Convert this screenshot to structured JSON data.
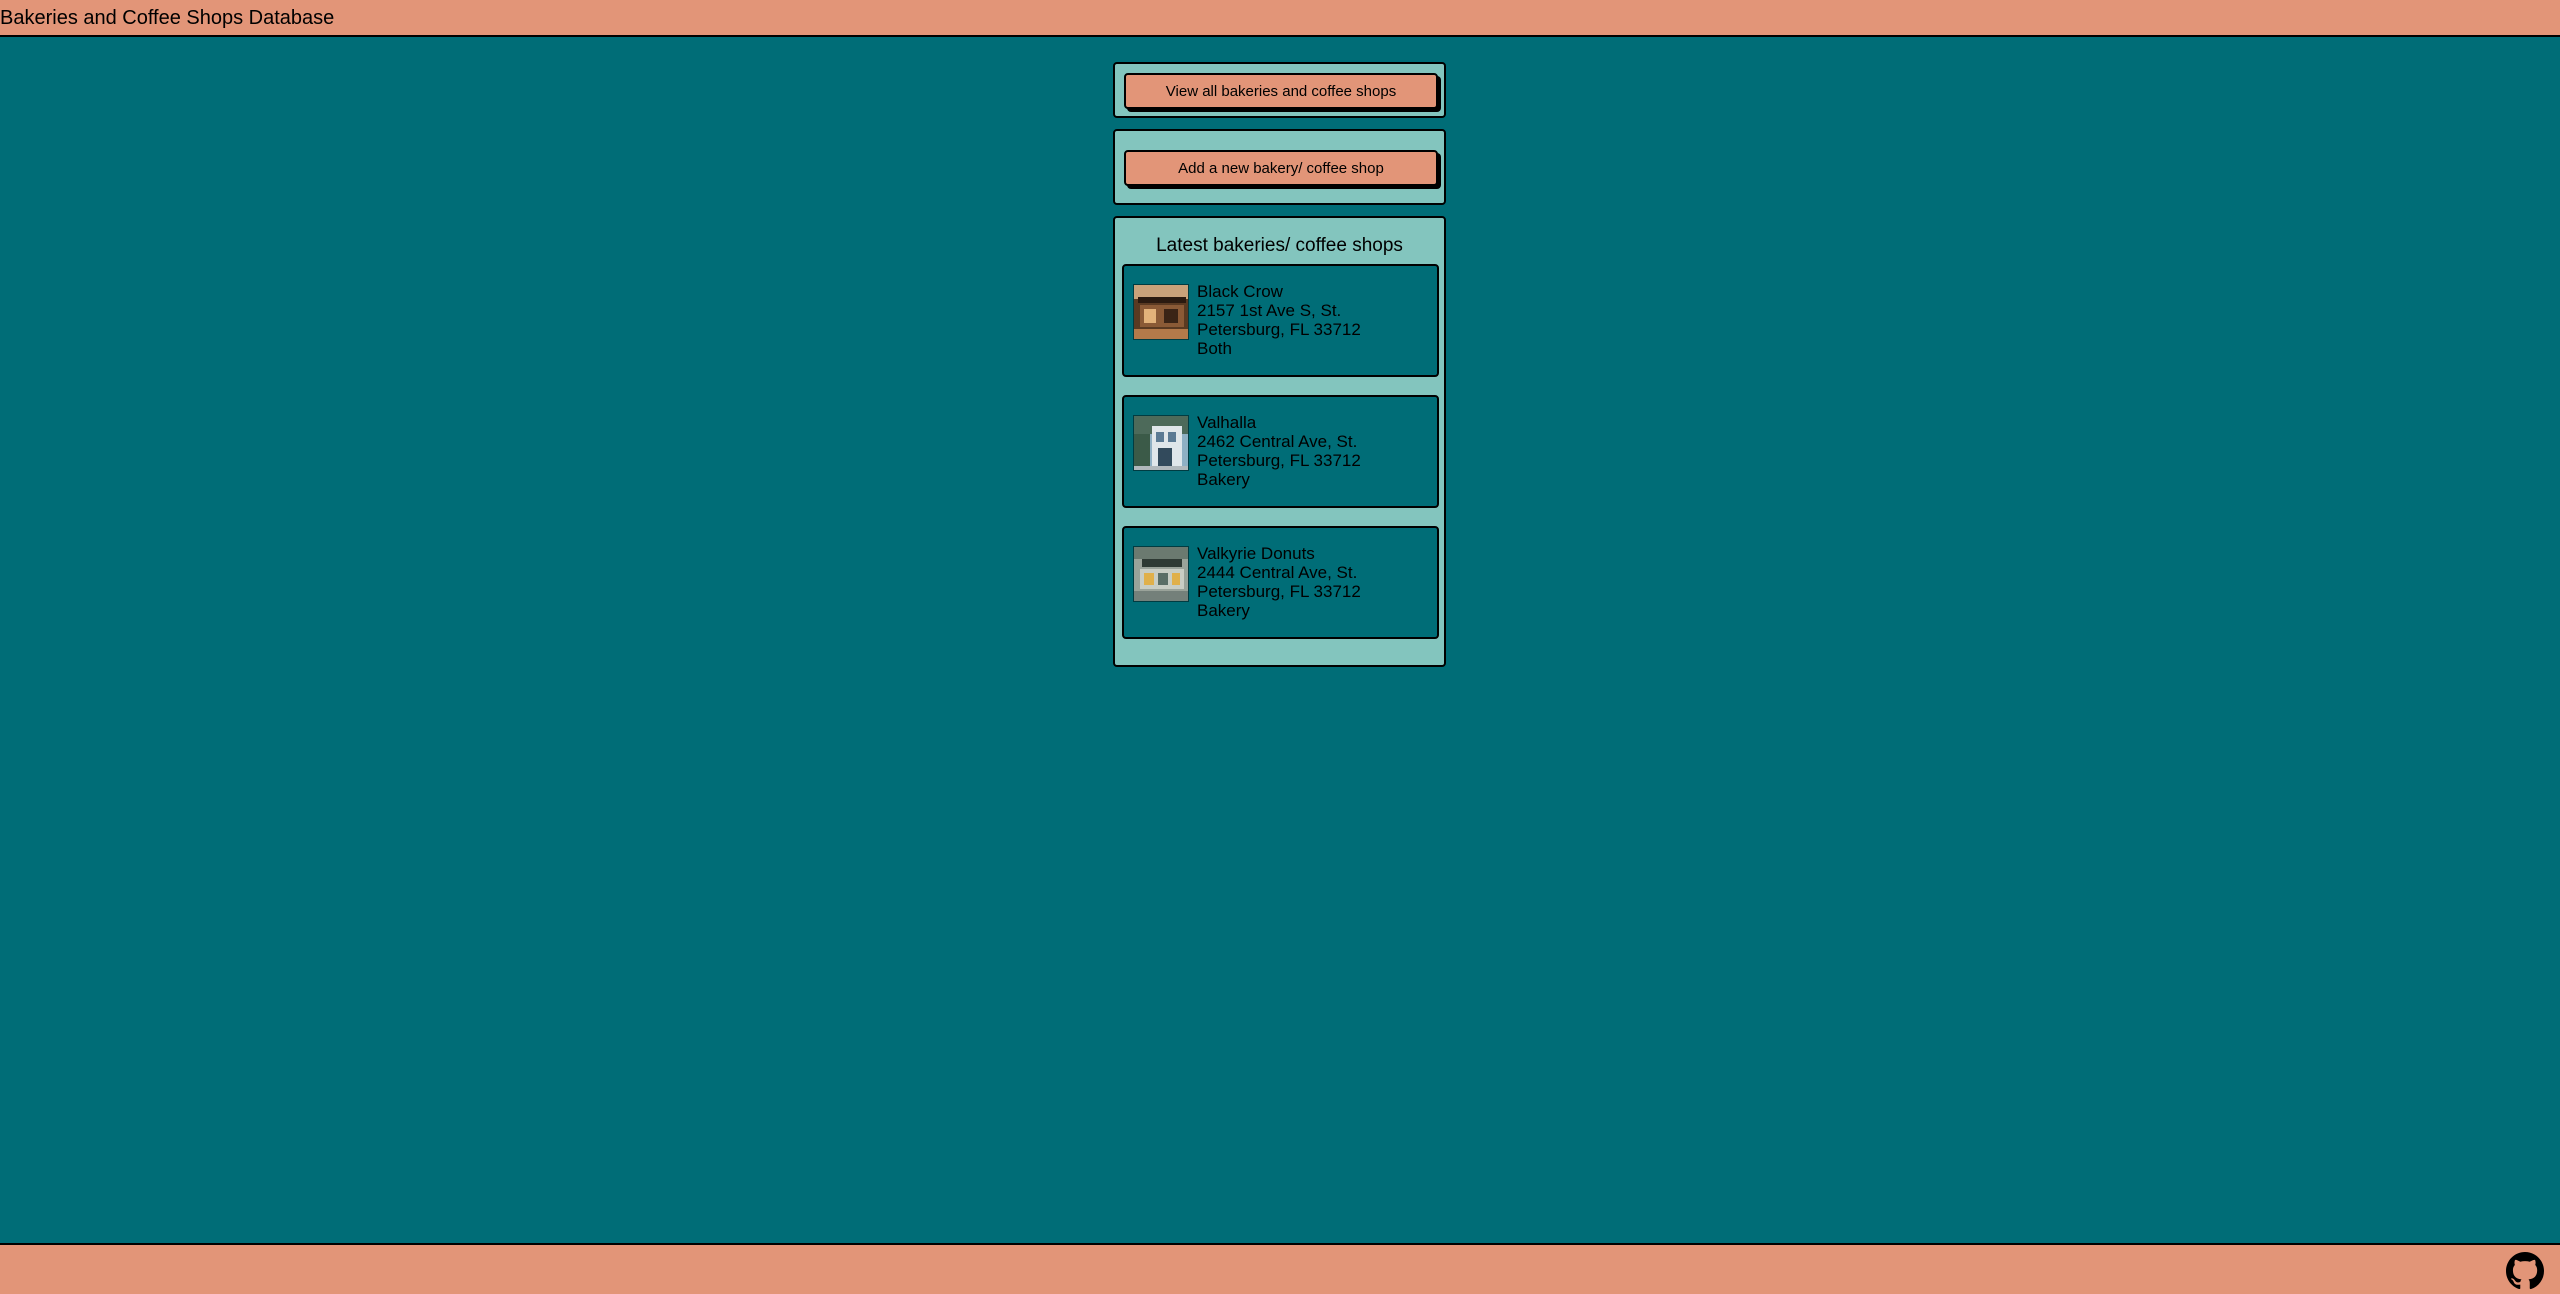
{
  "header": {
    "title": "Bakeries and Coffee Shops Database"
  },
  "actions": {
    "view_all_label": "View all bakeries and coffee shops",
    "add_new_label": "Add a new bakery/ coffee shop"
  },
  "latest": {
    "title": "Latest bakeries/ coffee shops",
    "items": [
      {
        "name": "Black Crow",
        "address": "2157 1st Ave S, St. Petersburg, FL 33712",
        "type": "Both"
      },
      {
        "name": "Valhalla",
        "address": "2462 Central Ave, St. Petersburg, FL 33712",
        "type": "Bakery"
      },
      {
        "name": "Valkyrie Donuts",
        "address": "2444 Central Ave, St. Petersburg, FL 33712",
        "type": "Bakery"
      }
    ]
  },
  "footer": {
    "github_icon": "github-icon"
  },
  "colors": {
    "background": "#006d77",
    "bar": "#e29578",
    "panel": "#83c5be",
    "button": "#e29578"
  }
}
